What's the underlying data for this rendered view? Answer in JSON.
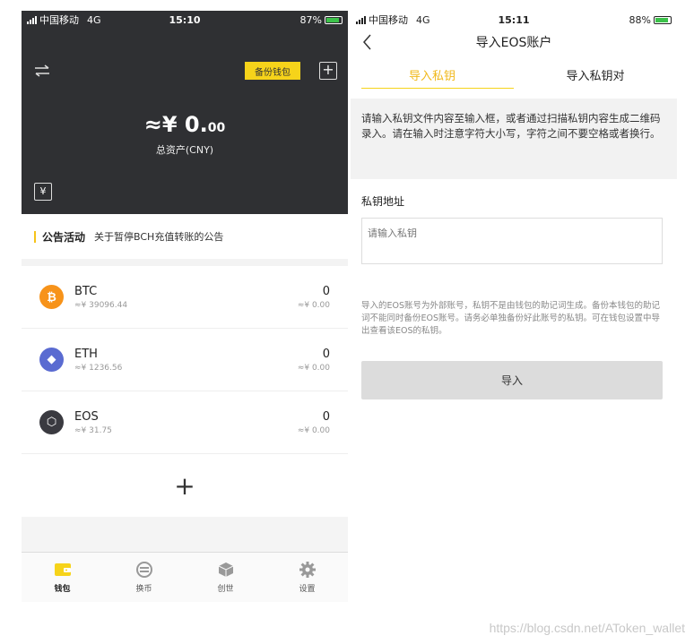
{
  "left": {
    "status": {
      "carrier": "中国移动",
      "network": "4G",
      "time": "15:10",
      "battery": "87%",
      "battery_level": 0.87
    },
    "header": {
      "backup_label": "备份钱包",
      "add_icon": "plus-square-icon",
      "swap_icon": "swap-arrows-icon"
    },
    "balance": {
      "prefix": "≈¥ ",
      "main": "0.",
      "decimals": "00",
      "label": "总资产(CNY)"
    },
    "yen_label": "¥",
    "notice": {
      "title": "公告活动",
      "text": "关于暂停BCH充值转账的公告"
    },
    "assets": [
      {
        "name": "BTC",
        "price": "≈¥ 39096.44",
        "amount": "0",
        "value": "≈¥ 0.00",
        "color": "#f7931a",
        "glyph": "₿"
      },
      {
        "name": "ETH",
        "price": "≈¥ 1236.56",
        "amount": "0",
        "value": "≈¥ 0.00",
        "color": "#5a6bd1",
        "glyph": "◆"
      },
      {
        "name": "EOS",
        "price": "≈¥ 31.75",
        "amount": "0",
        "value": "≈¥ 0.00",
        "color": "#3a3a40",
        "glyph": "⬡"
      }
    ],
    "add_asset": "+",
    "tabs": [
      {
        "label": "钱包",
        "icon": "wallet-icon"
      },
      {
        "label": "换币",
        "icon": "exchange-icon"
      },
      {
        "label": "创世",
        "icon": "cube-icon"
      },
      {
        "label": "设置",
        "icon": "gear-icon"
      }
    ]
  },
  "right": {
    "status": {
      "carrier": "中国移动",
      "network": "4G",
      "time": "15:11",
      "battery": "88%",
      "battery_level": 0.88
    },
    "title": "导入EOS账户",
    "tabs": [
      "导入私钥",
      "导入私钥对"
    ],
    "instructions": "请输入私钥文件内容至输入框，或者通过扫描私钥内容生成二维码录入。请在输入时注意字符大小写，字符之间不要空格或者换行。",
    "field_label": "私钥地址",
    "input_placeholder": "请输入私钥",
    "notes": "导入的EOS账号为外部账号，私钥不是由钱包的助记词生成。备份本钱包的助记词不能同时备份EOS账号。请务必单独备份好此账号的私钥。可在钱包设置中导出查看该EOS的私钥。",
    "import_button": "导入"
  },
  "watermark": "https://blog.csdn.net/AToken_wallet",
  "colors": {
    "accent": "#f6d31a",
    "dark_panel": "#2f3033"
  }
}
